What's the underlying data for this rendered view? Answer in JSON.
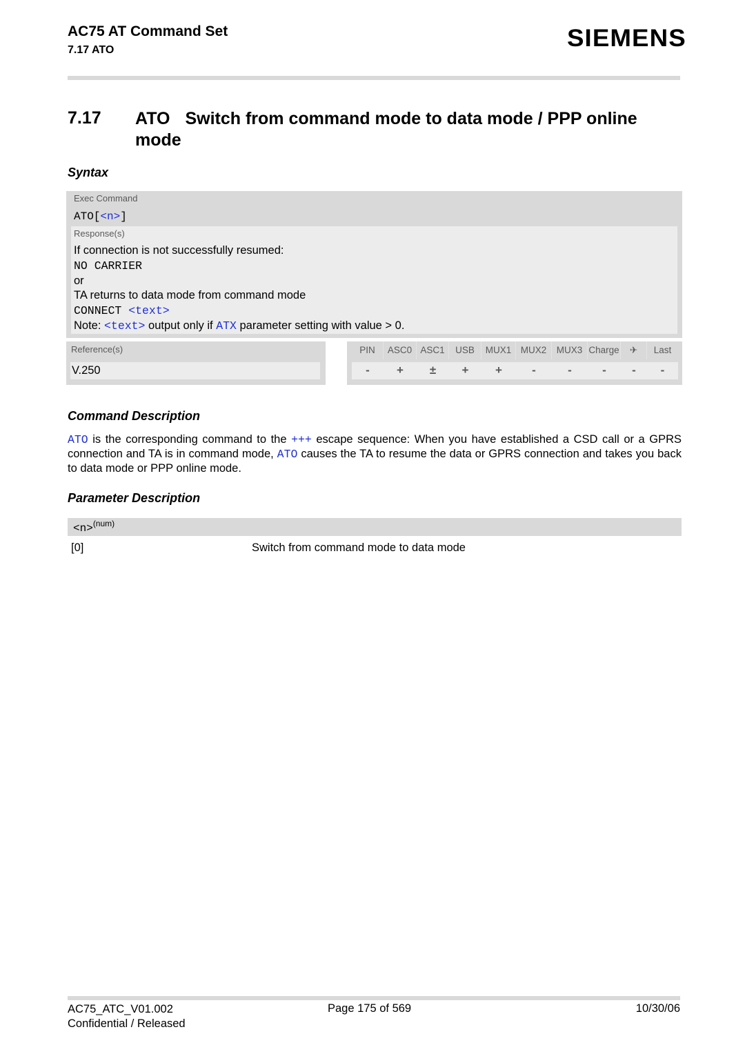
{
  "header": {
    "doc_title": "AC75 AT Command Set",
    "section_ref": "7.17 ATO",
    "logo_text": "SIEMENS"
  },
  "section": {
    "number": "7.17",
    "command": "ATO",
    "title": "Switch from command mode to data mode / PPP online mode"
  },
  "syntax": {
    "heading": "Syntax",
    "exec_label": "Exec Command",
    "exec_cmd_prefix": "ATO[",
    "exec_cmd_param": "<n>",
    "exec_cmd_suffix": "]",
    "responses_label": "Response(s)",
    "resp_line1": "If connection is not successfully resumed:",
    "resp_line2": "NO CARRIER",
    "resp_line3": "or",
    "resp_line4": "TA returns to data mode from command mode",
    "resp_line5_prefix": "CONNECT ",
    "resp_line5_param": "<text>",
    "note_prefix": "Note: ",
    "note_param": "<text>",
    "note_mid": " output only if ",
    "note_cmd": "ATX",
    "note_suffix": " parameter setting with value > 0."
  },
  "references": {
    "label": "Reference(s)",
    "value": "V.250"
  },
  "attributes": {
    "columns": [
      {
        "label": "PIN",
        "value": "-"
      },
      {
        "label": "ASC0",
        "value": "+"
      },
      {
        "label": "ASC1",
        "value": "±"
      },
      {
        "label": "USB",
        "value": "+"
      },
      {
        "label": "MUX1",
        "value": "+"
      },
      {
        "label": "MUX2",
        "value": "-"
      },
      {
        "label": "MUX3",
        "value": "-"
      },
      {
        "label": "Charge",
        "value": "-"
      },
      {
        "label": "✈",
        "value": "-",
        "icon": "airplane-icon"
      },
      {
        "label": "Last",
        "value": "-"
      }
    ]
  },
  "command_description": {
    "heading": "Command Description",
    "p_cmd1": "ATO",
    "p_text1": " is the corresponding command to the ",
    "p_esc": "+++",
    "p_text2": " escape sequence: When you have established a CSD call or a GPRS connection and TA is in command mode, ",
    "p_cmd2": "ATO",
    "p_text3": " causes the TA to resume the data or GPRS connection and takes you back to data mode or PPP online mode."
  },
  "parameter_description": {
    "heading": "Parameter Description",
    "param_name": "<n>",
    "param_type": "(num)",
    "values": [
      {
        "key": "[0]",
        "desc": "Switch from command mode to data mode"
      }
    ]
  },
  "footer": {
    "doc_id": "AC75_ATC_V01.002",
    "classification": "Confidential / Released",
    "page": "Page 175 of 569",
    "date": "10/30/06"
  }
}
